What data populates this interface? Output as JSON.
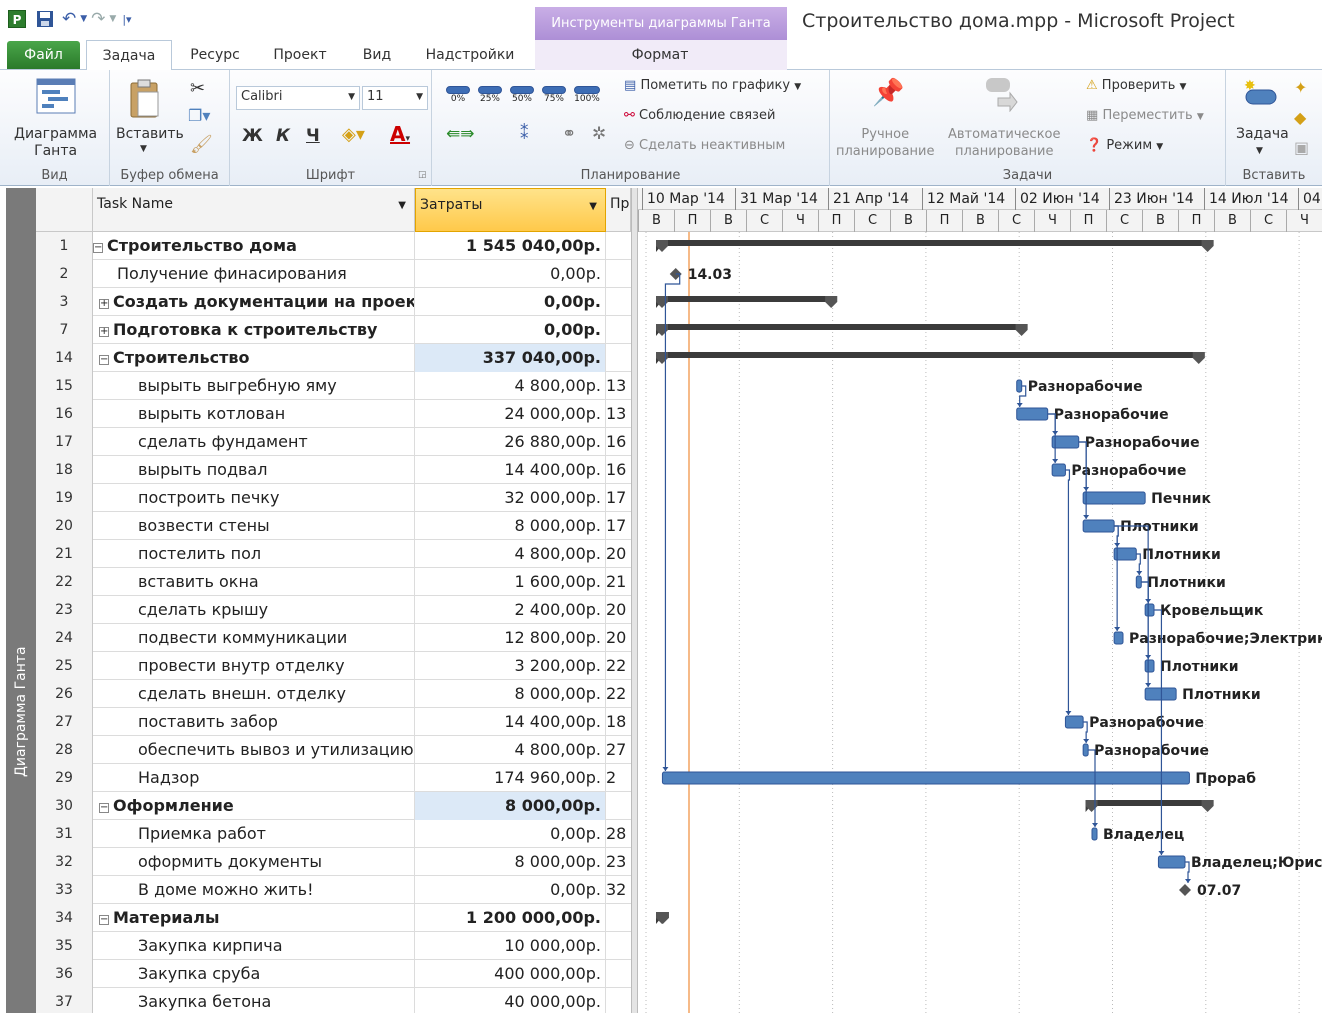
{
  "app": {
    "doc_title": "Строительство дома.mpp  -  Microsoft Project",
    "context_tab": "Инструменты диаграммы Ганта",
    "qat_icon": "P"
  },
  "tabs": [
    "Файл",
    "Задача",
    "Ресурс",
    "Проект",
    "Вид",
    "Надстройки",
    "Формат"
  ],
  "ribbon": {
    "view": {
      "button": "Диаграмма\nГанта",
      "label": "Вид"
    },
    "clipboard": {
      "paste": "Вставить",
      "label": "Буфер обмена"
    },
    "font": {
      "family": "Calibri",
      "size": "11",
      "bold": "Ж",
      "italic": "К",
      "underline": "Ч",
      "label": "Шрифт"
    },
    "schedule": {
      "pct": [
        "0%",
        "25%",
        "50%",
        "75%",
        "100%"
      ],
      "mark_on_track": "Пометить по графику",
      "respect_links": "Соблюдение связей",
      "inactivate": "Сделать неактивным",
      "label": "Планирование"
    },
    "tasks": {
      "manual": "Ручное\nпланирование",
      "auto": "Автоматическое\nпланирование",
      "inspect": "Проверить",
      "move": "Переместить",
      "mode": "Режим",
      "label": "Задачи"
    },
    "insert": {
      "task": "Задача",
      "label": "Вставить"
    }
  },
  "view_strip_label": "Диаграмма Ганта",
  "grid": {
    "headers": {
      "name": "Task Name",
      "cost": "Затраты",
      "pred": "Пр"
    },
    "rows": [
      {
        "id": "1",
        "name": "Строительство дома",
        "cost": "1 545 040,00р.",
        "pred": "",
        "level": 0,
        "summary": true,
        "toggle": "−"
      },
      {
        "id": "2",
        "name": "Получение финасирования",
        "cost": "0,00р.",
        "pred": "",
        "level": 1,
        "summary": false
      },
      {
        "id": "3",
        "name": "Создать документации на проект",
        "cost": "0,00р.",
        "pred": "",
        "level": 1,
        "summary": true,
        "toggle": "+"
      },
      {
        "id": "7",
        "name": "Подготовка к строительству",
        "cost": "0,00р.",
        "pred": "",
        "level": 1,
        "summary": true,
        "toggle": "+"
      },
      {
        "id": "14",
        "name": "Строительство",
        "cost": "337 040,00р.",
        "pred": "",
        "level": 1,
        "summary": true,
        "toggle": "−",
        "hl": true
      },
      {
        "id": "15",
        "name": "вырыть выгребную яму",
        "cost": "4 800,00р.",
        "pred": "13",
        "level": 2
      },
      {
        "id": "16",
        "name": "вырыть котлован",
        "cost": "24 000,00р.",
        "pred": "13",
        "level": 2
      },
      {
        "id": "17",
        "name": "сделать фундамент",
        "cost": "26 880,00р.",
        "pred": "16",
        "level": 2
      },
      {
        "id": "18",
        "name": "вырыть подвал",
        "cost": "14 400,00р.",
        "pred": "16",
        "level": 2
      },
      {
        "id": "19",
        "name": "построить печку",
        "cost": "32 000,00р.",
        "pred": "17",
        "level": 2
      },
      {
        "id": "20",
        "name": "возвести стены",
        "cost": "8 000,00р.",
        "pred": "17",
        "level": 2
      },
      {
        "id": "21",
        "name": "постелить пол",
        "cost": "4 800,00р.",
        "pred": "20",
        "level": 2
      },
      {
        "id": "22",
        "name": "вставить окна",
        "cost": "1 600,00р.",
        "pred": "21",
        "level": 2
      },
      {
        "id": "23",
        "name": "сделать крышу",
        "cost": "2 400,00р.",
        "pred": "20",
        "level": 2
      },
      {
        "id": "24",
        "name": "подвести коммуникации",
        "cost": "12 800,00р.",
        "pred": "20",
        "level": 2
      },
      {
        "id": "25",
        "name": "провести внутр отделку",
        "cost": "3 200,00р.",
        "pred": "22",
        "level": 2
      },
      {
        "id": "26",
        "name": "сделать внешн. отделку",
        "cost": "8 000,00р.",
        "pred": "22",
        "level": 2
      },
      {
        "id": "27",
        "name": "поставить забор",
        "cost": "14 400,00р.",
        "pred": "18",
        "level": 2
      },
      {
        "id": "28",
        "name": "обеспечить вывоз и утилизацию",
        "cost": "4 800,00р.",
        "pred": "27",
        "level": 2
      },
      {
        "id": "29",
        "name": "Надзор",
        "cost": "174 960,00р.",
        "pred": "2",
        "level": 2
      },
      {
        "id": "30",
        "name": "Оформление",
        "cost": "8 000,00р.",
        "pred": "",
        "level": 1,
        "summary": true,
        "toggle": "−",
        "hl": true
      },
      {
        "id": "31",
        "name": "Приемка работ",
        "cost": "0,00р.",
        "pred": "28",
        "level": 2
      },
      {
        "id": "32",
        "name": "оформить документы",
        "cost": "8 000,00р.",
        "pred": "23",
        "level": 2
      },
      {
        "id": "33",
        "name": "В доме можно жить!",
        "cost": "0,00р.",
        "pred": "32",
        "level": 2
      },
      {
        "id": "34",
        "name": "Материалы",
        "cost": "1 200 000,00р.",
        "pred": "",
        "level": 1,
        "summary": true,
        "toggle": "−"
      },
      {
        "id": "35",
        "name": "Закупка кирпича",
        "cost": "10 000,00р.",
        "pred": "",
        "level": 2
      },
      {
        "id": "36",
        "name": "Закупка сруба",
        "cost": "400 000,00р.",
        "pred": "",
        "level": 2
      },
      {
        "id": "37",
        "name": "Закупка бетона",
        "cost": "40 000,00р.",
        "pred": "",
        "level": 2
      }
    ]
  },
  "timeline": {
    "months": [
      "10 Мар '14",
      "31 Мар '14",
      "21 Апр '14",
      "12 Май '14",
      "02 Июн '14",
      "23 Июн '14",
      "14 Июл '14",
      "04"
    ],
    "days": [
      "В",
      "П",
      "В",
      "С",
      "Ч",
      "П",
      "С",
      "В",
      "П",
      "В",
      "С",
      "Ч",
      "П",
      "С",
      "В",
      "П",
      "В",
      "С",
      "Ч"
    ]
  },
  "gantt": {
    "colors": {
      "summary": "#3b3b3b",
      "task": "#4f81bd",
      "task_edge": "#2f5597",
      "link": "#2f5597",
      "today": "#f4a460",
      "milestone": "#555555"
    },
    "items": [
      {
        "row": 0,
        "type": "summary",
        "start": "2014-03-10",
        "finish": "2014-07-13"
      },
      {
        "row": 1,
        "type": "milestone",
        "date": "2014-03-14",
        "label": "14.03"
      },
      {
        "row": 2,
        "type": "summary",
        "start": "2014-03-10",
        "finish": "2014-04-19"
      },
      {
        "row": 3,
        "type": "summary",
        "start": "2014-03-10",
        "finish": "2014-06-01"
      },
      {
        "row": 4,
        "type": "summary",
        "start": "2014-03-10",
        "finish": "2014-07-11"
      },
      {
        "row": 5,
        "type": "task",
        "start": "2014-05-30",
        "finish": "2014-05-31",
        "label": "Разнорабочие"
      },
      {
        "row": 6,
        "type": "task",
        "start": "2014-05-30",
        "finish": "2014-06-06",
        "label": "Разнорабочие"
      },
      {
        "row": 7,
        "type": "task",
        "start": "2014-06-07",
        "finish": "2014-06-13",
        "label": "Разнорабочие"
      },
      {
        "row": 8,
        "type": "task",
        "start": "2014-06-07",
        "finish": "2014-06-10",
        "label": "Разнорабочие"
      },
      {
        "row": 9,
        "type": "task",
        "start": "2014-06-14",
        "finish": "2014-06-28",
        "label": "Печник"
      },
      {
        "row": 10,
        "type": "task",
        "start": "2014-06-14",
        "finish": "2014-06-21",
        "label": "Плотники"
      },
      {
        "row": 11,
        "type": "task",
        "start": "2014-06-21",
        "finish": "2014-06-26",
        "label": "Плотники"
      },
      {
        "row": 12,
        "type": "task",
        "start": "2014-06-26",
        "finish": "2014-06-27",
        "label": "Плотники"
      },
      {
        "row": 13,
        "type": "task",
        "start": "2014-06-28",
        "finish": "2014-06-30",
        "label": "Кровельщик"
      },
      {
        "row": 14,
        "type": "task",
        "start": "2014-06-21",
        "finish": "2014-06-23",
        "label": "Разнорабочие;Электрик"
      },
      {
        "row": 15,
        "type": "task",
        "start": "2014-06-28",
        "finish": "2014-06-30",
        "label": "Плотники"
      },
      {
        "row": 16,
        "type": "task",
        "start": "2014-06-28",
        "finish": "2014-07-05",
        "label": "Плотники"
      },
      {
        "row": 17,
        "type": "task",
        "start": "2014-06-10",
        "finish": "2014-06-14",
        "label": "Разнорабочие"
      },
      {
        "row": 18,
        "type": "task",
        "start": "2014-06-14",
        "finish": "2014-06-15",
        "label": "Разнорабочие"
      },
      {
        "row": 19,
        "type": "task",
        "start": "2014-03-11",
        "finish": "2014-07-08",
        "label": "Прораб"
      },
      {
        "row": 20,
        "type": "summary",
        "start": "2014-06-15",
        "finish": "2014-07-13"
      },
      {
        "row": 21,
        "type": "task",
        "start": "2014-06-16",
        "finish": "2014-06-17",
        "label": "Владелец"
      },
      {
        "row": 22,
        "type": "task",
        "start": "2014-07-01",
        "finish": "2014-07-07",
        "label": "Владелец;Юрист"
      },
      {
        "row": 23,
        "type": "milestone",
        "date": "2014-07-07",
        "label": "07.07"
      },
      {
        "row": 24,
        "type": "summary",
        "start": "2014-03-10",
        "finish": "2014-03-12"
      }
    ],
    "links": [
      {
        "from": 1,
        "to": 19
      },
      {
        "from": 5,
        "to": 6
      },
      {
        "from": 6,
        "to": 7
      },
      {
        "from": 6,
        "to": 8
      },
      {
        "from": 7,
        "to": 9
      },
      {
        "from": 7,
        "to": 10
      },
      {
        "from": 10,
        "to": 11
      },
      {
        "from": 11,
        "to": 12
      },
      {
        "from": 10,
        "to": 13
      },
      {
        "from": 10,
        "to": 14
      },
      {
        "from": 12,
        "to": 15
      },
      {
        "from": 12,
        "to": 16
      },
      {
        "from": 8,
        "to": 17
      },
      {
        "from": 17,
        "to": 18
      },
      {
        "from": 18,
        "to": 21
      },
      {
        "from": 13,
        "to": 22
      },
      {
        "from": 22,
        "to": 23
      }
    ]
  }
}
